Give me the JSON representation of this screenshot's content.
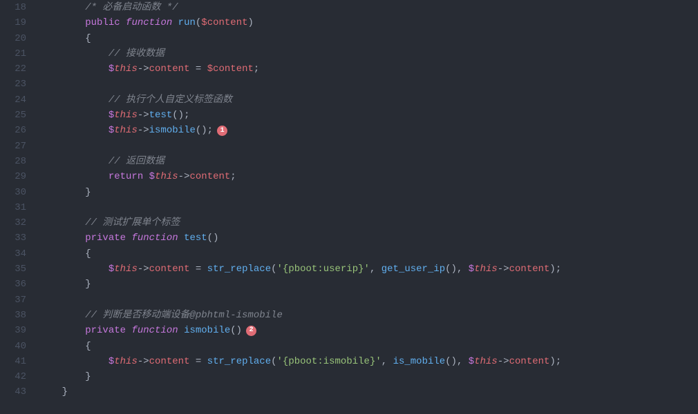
{
  "startLine": 18,
  "lines": [
    {
      "n": 18,
      "indent": 8,
      "tokens": [
        [
          "cmt",
          "/* 必备启动函数 */"
        ]
      ]
    },
    {
      "n": 19,
      "indent": 8,
      "tokens": [
        [
          "kw",
          "public"
        ],
        [
          "sp",
          " "
        ],
        [
          "fnk",
          "function"
        ],
        [
          "sp",
          " "
        ],
        [
          "fn",
          "run"
        ],
        [
          "punc",
          "("
        ],
        [
          "var",
          "$content"
        ],
        [
          "punc",
          ")"
        ]
      ]
    },
    {
      "n": 20,
      "indent": 8,
      "tokens": [
        [
          "punc",
          "{"
        ]
      ]
    },
    {
      "n": 21,
      "indent": 12,
      "tokens": [
        [
          "cmt",
          "// 接收数据"
        ]
      ]
    },
    {
      "n": 22,
      "indent": 12,
      "tokens": [
        [
          "doll",
          "$"
        ],
        [
          "this",
          "this"
        ],
        [
          "punc",
          "->"
        ],
        [
          "prop",
          "content"
        ],
        [
          "sp",
          " "
        ],
        [
          "punc",
          "="
        ],
        [
          "sp",
          " "
        ],
        [
          "var",
          "$content"
        ],
        [
          "punc",
          ";"
        ]
      ]
    },
    {
      "n": 23,
      "indent": 0,
      "tokens": []
    },
    {
      "n": 24,
      "indent": 12,
      "tokens": [
        [
          "cmt",
          "// 执行个人自定义标签函数"
        ]
      ]
    },
    {
      "n": 25,
      "indent": 12,
      "tokens": [
        [
          "doll",
          "$"
        ],
        [
          "this",
          "this"
        ],
        [
          "punc",
          "->"
        ],
        [
          "fn",
          "test"
        ],
        [
          "punc",
          "();"
        ]
      ]
    },
    {
      "n": 26,
      "indent": 12,
      "tokens": [
        [
          "doll",
          "$"
        ],
        [
          "this",
          "this"
        ],
        [
          "punc",
          "->"
        ],
        [
          "fn",
          "ismobile"
        ],
        [
          "punc",
          "();"
        ]
      ],
      "badge": "1"
    },
    {
      "n": 27,
      "indent": 0,
      "tokens": []
    },
    {
      "n": 28,
      "indent": 12,
      "tokens": [
        [
          "cmt",
          "// 返回数据"
        ]
      ]
    },
    {
      "n": 29,
      "indent": 12,
      "tokens": [
        [
          "kw",
          "return"
        ],
        [
          "sp",
          " "
        ],
        [
          "doll",
          "$"
        ],
        [
          "this",
          "this"
        ],
        [
          "punc",
          "->"
        ],
        [
          "prop",
          "content"
        ],
        [
          "punc",
          ";"
        ]
      ]
    },
    {
      "n": 30,
      "indent": 8,
      "tokens": [
        [
          "punc",
          "}"
        ]
      ]
    },
    {
      "n": 31,
      "indent": 0,
      "tokens": []
    },
    {
      "n": 32,
      "indent": 8,
      "tokens": [
        [
          "cmt",
          "// 测试扩展单个标签"
        ]
      ]
    },
    {
      "n": 33,
      "indent": 8,
      "tokens": [
        [
          "kw",
          "private"
        ],
        [
          "sp",
          " "
        ],
        [
          "fnk",
          "function"
        ],
        [
          "sp",
          " "
        ],
        [
          "fn",
          "test"
        ],
        [
          "punc",
          "()"
        ]
      ]
    },
    {
      "n": 34,
      "indent": 8,
      "tokens": [
        [
          "punc",
          "{"
        ]
      ]
    },
    {
      "n": 35,
      "indent": 12,
      "tokens": [
        [
          "doll",
          "$"
        ],
        [
          "this",
          "this"
        ],
        [
          "punc",
          "->"
        ],
        [
          "prop",
          "content"
        ],
        [
          "sp",
          " "
        ],
        [
          "punc",
          "="
        ],
        [
          "sp",
          " "
        ],
        [
          "fn",
          "str_replace"
        ],
        [
          "punc",
          "("
        ],
        [
          "str",
          "'{pboot:userip}'"
        ],
        [
          "punc",
          ", "
        ],
        [
          "fn",
          "get_user_ip"
        ],
        [
          "punc",
          "(), "
        ],
        [
          "doll",
          "$"
        ],
        [
          "this",
          "this"
        ],
        [
          "punc",
          "->"
        ],
        [
          "prop",
          "content"
        ],
        [
          "punc",
          ");"
        ]
      ]
    },
    {
      "n": 36,
      "indent": 8,
      "tokens": [
        [
          "punc",
          "}"
        ]
      ]
    },
    {
      "n": 37,
      "indent": 0,
      "tokens": []
    },
    {
      "n": 38,
      "indent": 8,
      "tokens": [
        [
          "cmt",
          "// 判断是否移动端设备@pbhtml-ismobile"
        ]
      ]
    },
    {
      "n": 39,
      "indent": 8,
      "tokens": [
        [
          "kw",
          "private"
        ],
        [
          "sp",
          " "
        ],
        [
          "fnk",
          "function"
        ],
        [
          "sp",
          " "
        ],
        [
          "fn",
          "ismobile"
        ],
        [
          "punc",
          "()"
        ]
      ],
      "badge": "2"
    },
    {
      "n": 40,
      "indent": 8,
      "tokens": [
        [
          "punc",
          "{"
        ]
      ]
    },
    {
      "n": 41,
      "indent": 12,
      "tokens": [
        [
          "doll",
          "$"
        ],
        [
          "this",
          "this"
        ],
        [
          "punc",
          "->"
        ],
        [
          "prop",
          "content"
        ],
        [
          "sp",
          " "
        ],
        [
          "punc",
          "="
        ],
        [
          "sp",
          " "
        ],
        [
          "fn",
          "str_replace"
        ],
        [
          "punc",
          "("
        ],
        [
          "str",
          "'{pboot:ismobile}'"
        ],
        [
          "punc",
          ", "
        ],
        [
          "fn",
          "is_mobile"
        ],
        [
          "punc",
          "(), "
        ],
        [
          "doll",
          "$"
        ],
        [
          "this",
          "this"
        ],
        [
          "punc",
          "->"
        ],
        [
          "prop",
          "content"
        ],
        [
          "punc",
          ");"
        ]
      ]
    },
    {
      "n": 42,
      "indent": 8,
      "tokens": [
        [
          "punc",
          "}"
        ]
      ]
    },
    {
      "n": 43,
      "indent": 4,
      "tokens": [
        [
          "punc",
          "}"
        ]
      ]
    }
  ],
  "tokenClass": {
    "kw": "c-kw",
    "fnk": "c-fnk",
    "fn": "c-fn",
    "var": "c-var",
    "this": "c-this",
    "doll": "c-doll",
    "cmt": "c-cmt",
    "prop": "c-prop",
    "str": "c-str",
    "punc": "c-punc",
    "sp": "c-def",
    "def": "c-def"
  }
}
